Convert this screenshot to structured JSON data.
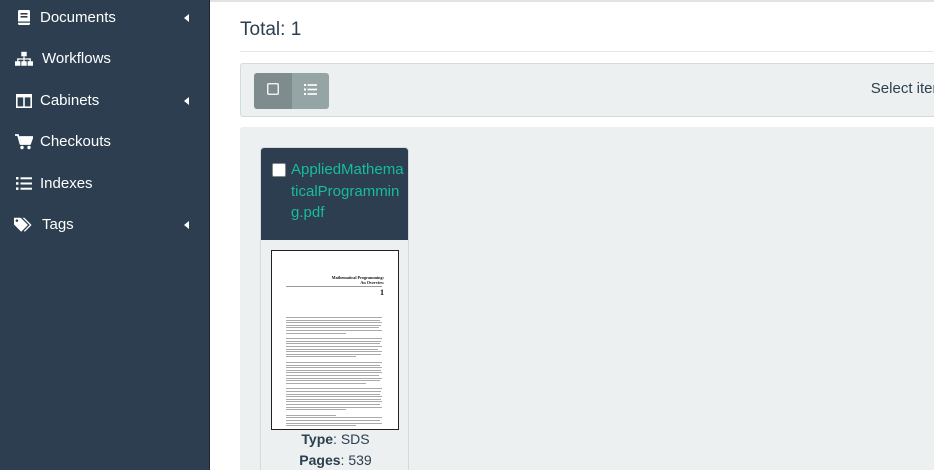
{
  "sidebar": {
    "items": [
      {
        "label": "Documents",
        "icon": "book-icon",
        "has_submenu": true
      },
      {
        "label": "Workflows",
        "icon": "sitemap-icon",
        "has_submenu": false
      },
      {
        "label": "Cabinets",
        "icon": "columns-icon",
        "has_submenu": true
      },
      {
        "label": "Checkouts",
        "icon": "shopping-cart-icon",
        "has_submenu": false
      },
      {
        "label": "Indexes",
        "icon": "list-icon",
        "has_submenu": false
      },
      {
        "label": "Tags",
        "icon": "tags-icon",
        "has_submenu": true
      }
    ]
  },
  "main": {
    "total_label": "Total: 1",
    "toolbar": {
      "select_items_label": "Select item",
      "view_modes": [
        "thumbnail",
        "list"
      ]
    },
    "documents": [
      {
        "title": "AppliedMathematicalProgramming.pdf",
        "thumbnail": {
          "heading": "Mathematical Programming:",
          "subheading": "An Overview",
          "chapter": "1"
        },
        "type_label": "Type",
        "type_value": "SDS",
        "pages_label": "Pages",
        "pages_value": "539"
      }
    ]
  },
  "colors": {
    "sidebar_bg": "#2c3e50",
    "accent": "#18bc9c",
    "panel_bg": "#ecf0f1",
    "toggle_bg": "#95a5a6"
  }
}
